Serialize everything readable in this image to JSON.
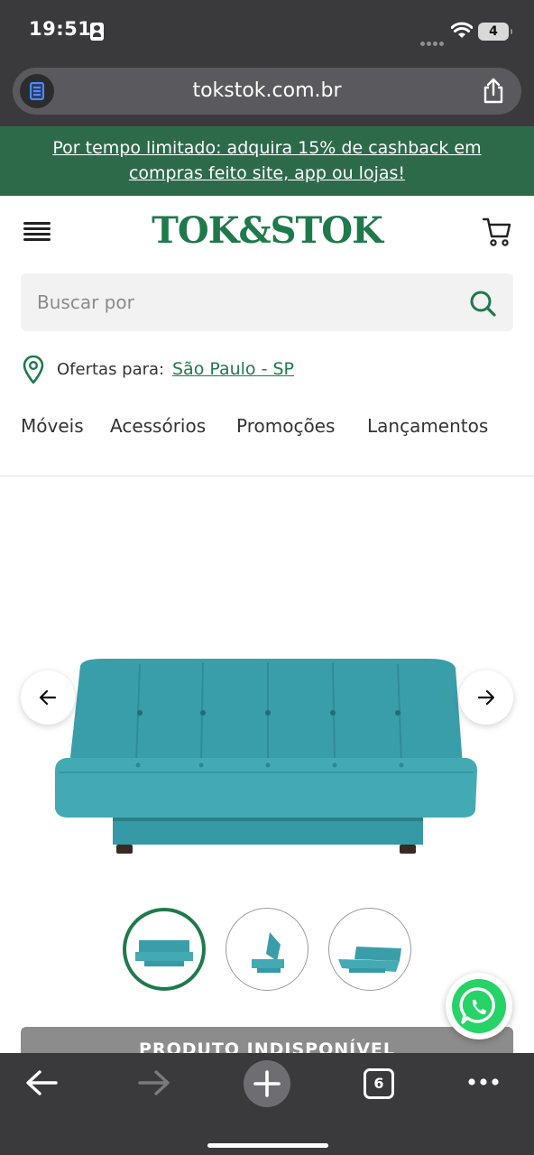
{
  "status_bar": {
    "time": "19:51",
    "battery": "4"
  },
  "browser": {
    "url": "tokstok.com.br",
    "tabs_count": "6"
  },
  "promo": {
    "text": "Por tempo limitado: adquira 15% de cashback em compras feito site, app ou lojas!"
  },
  "header": {
    "logo": "TOK&STOK"
  },
  "search": {
    "placeholder": "Buscar por"
  },
  "location": {
    "label": "Ofertas para:",
    "city": "São Paulo - SP"
  },
  "nav": {
    "items": [
      {
        "label": "Móveis"
      },
      {
        "label": "Acessórios"
      },
      {
        "label": "Promoções"
      },
      {
        "label": "Lançamentos"
      }
    ]
  },
  "product": {
    "color": "#3a9ea9",
    "thumbnail_count": 3,
    "selected_thumbnail": 1,
    "buy_button_label": "PRODUTO INDISPONÍVEL"
  },
  "colors": {
    "brand_green": "#1f7a4b",
    "promo_green": "#2d6a4a",
    "whatsapp_green": "#25d366",
    "browser_chrome": "#3a3a3c"
  }
}
